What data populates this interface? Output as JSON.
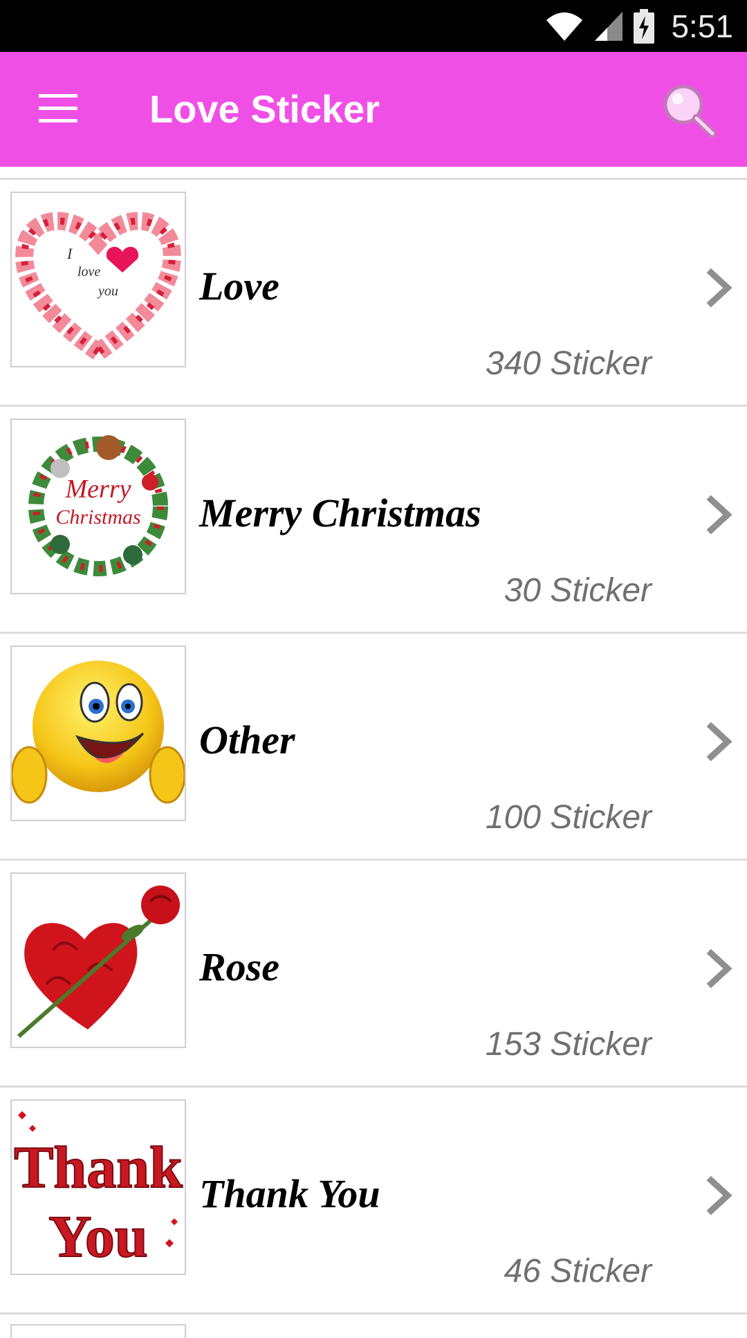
{
  "status_bar": {
    "time": "5:51",
    "icons": [
      "wifi-icon",
      "cell-signal-icon",
      "battery-charging-icon"
    ]
  },
  "app_bar": {
    "title": "Love Sticker",
    "menu_icon": "hamburger-menu-icon",
    "search_icon": "search-icon",
    "color": "#f04fe6"
  },
  "categories": [
    {
      "title": "Love",
      "count": "340 Sticker",
      "thumb": "heart-petals-icon"
    },
    {
      "title": "Merry Christmas",
      "count": "30 Sticker",
      "thumb": "christmas-wreath-icon"
    },
    {
      "title": "Other",
      "count": "100 Sticker",
      "thumb": "smiley-thumbs-up-icon"
    },
    {
      "title": "Rose",
      "count": "153 Sticker",
      "thumb": "rose-heart-icon"
    },
    {
      "title": "Thank You",
      "count": "46 Sticker",
      "thumb": "thank-you-glitter-icon"
    }
  ],
  "thumb_texts": {
    "love": [
      "I",
      "love",
      "you"
    ],
    "christmas": [
      "Merry",
      "Christmas"
    ],
    "thankyou": [
      "Thank",
      "You"
    ]
  }
}
